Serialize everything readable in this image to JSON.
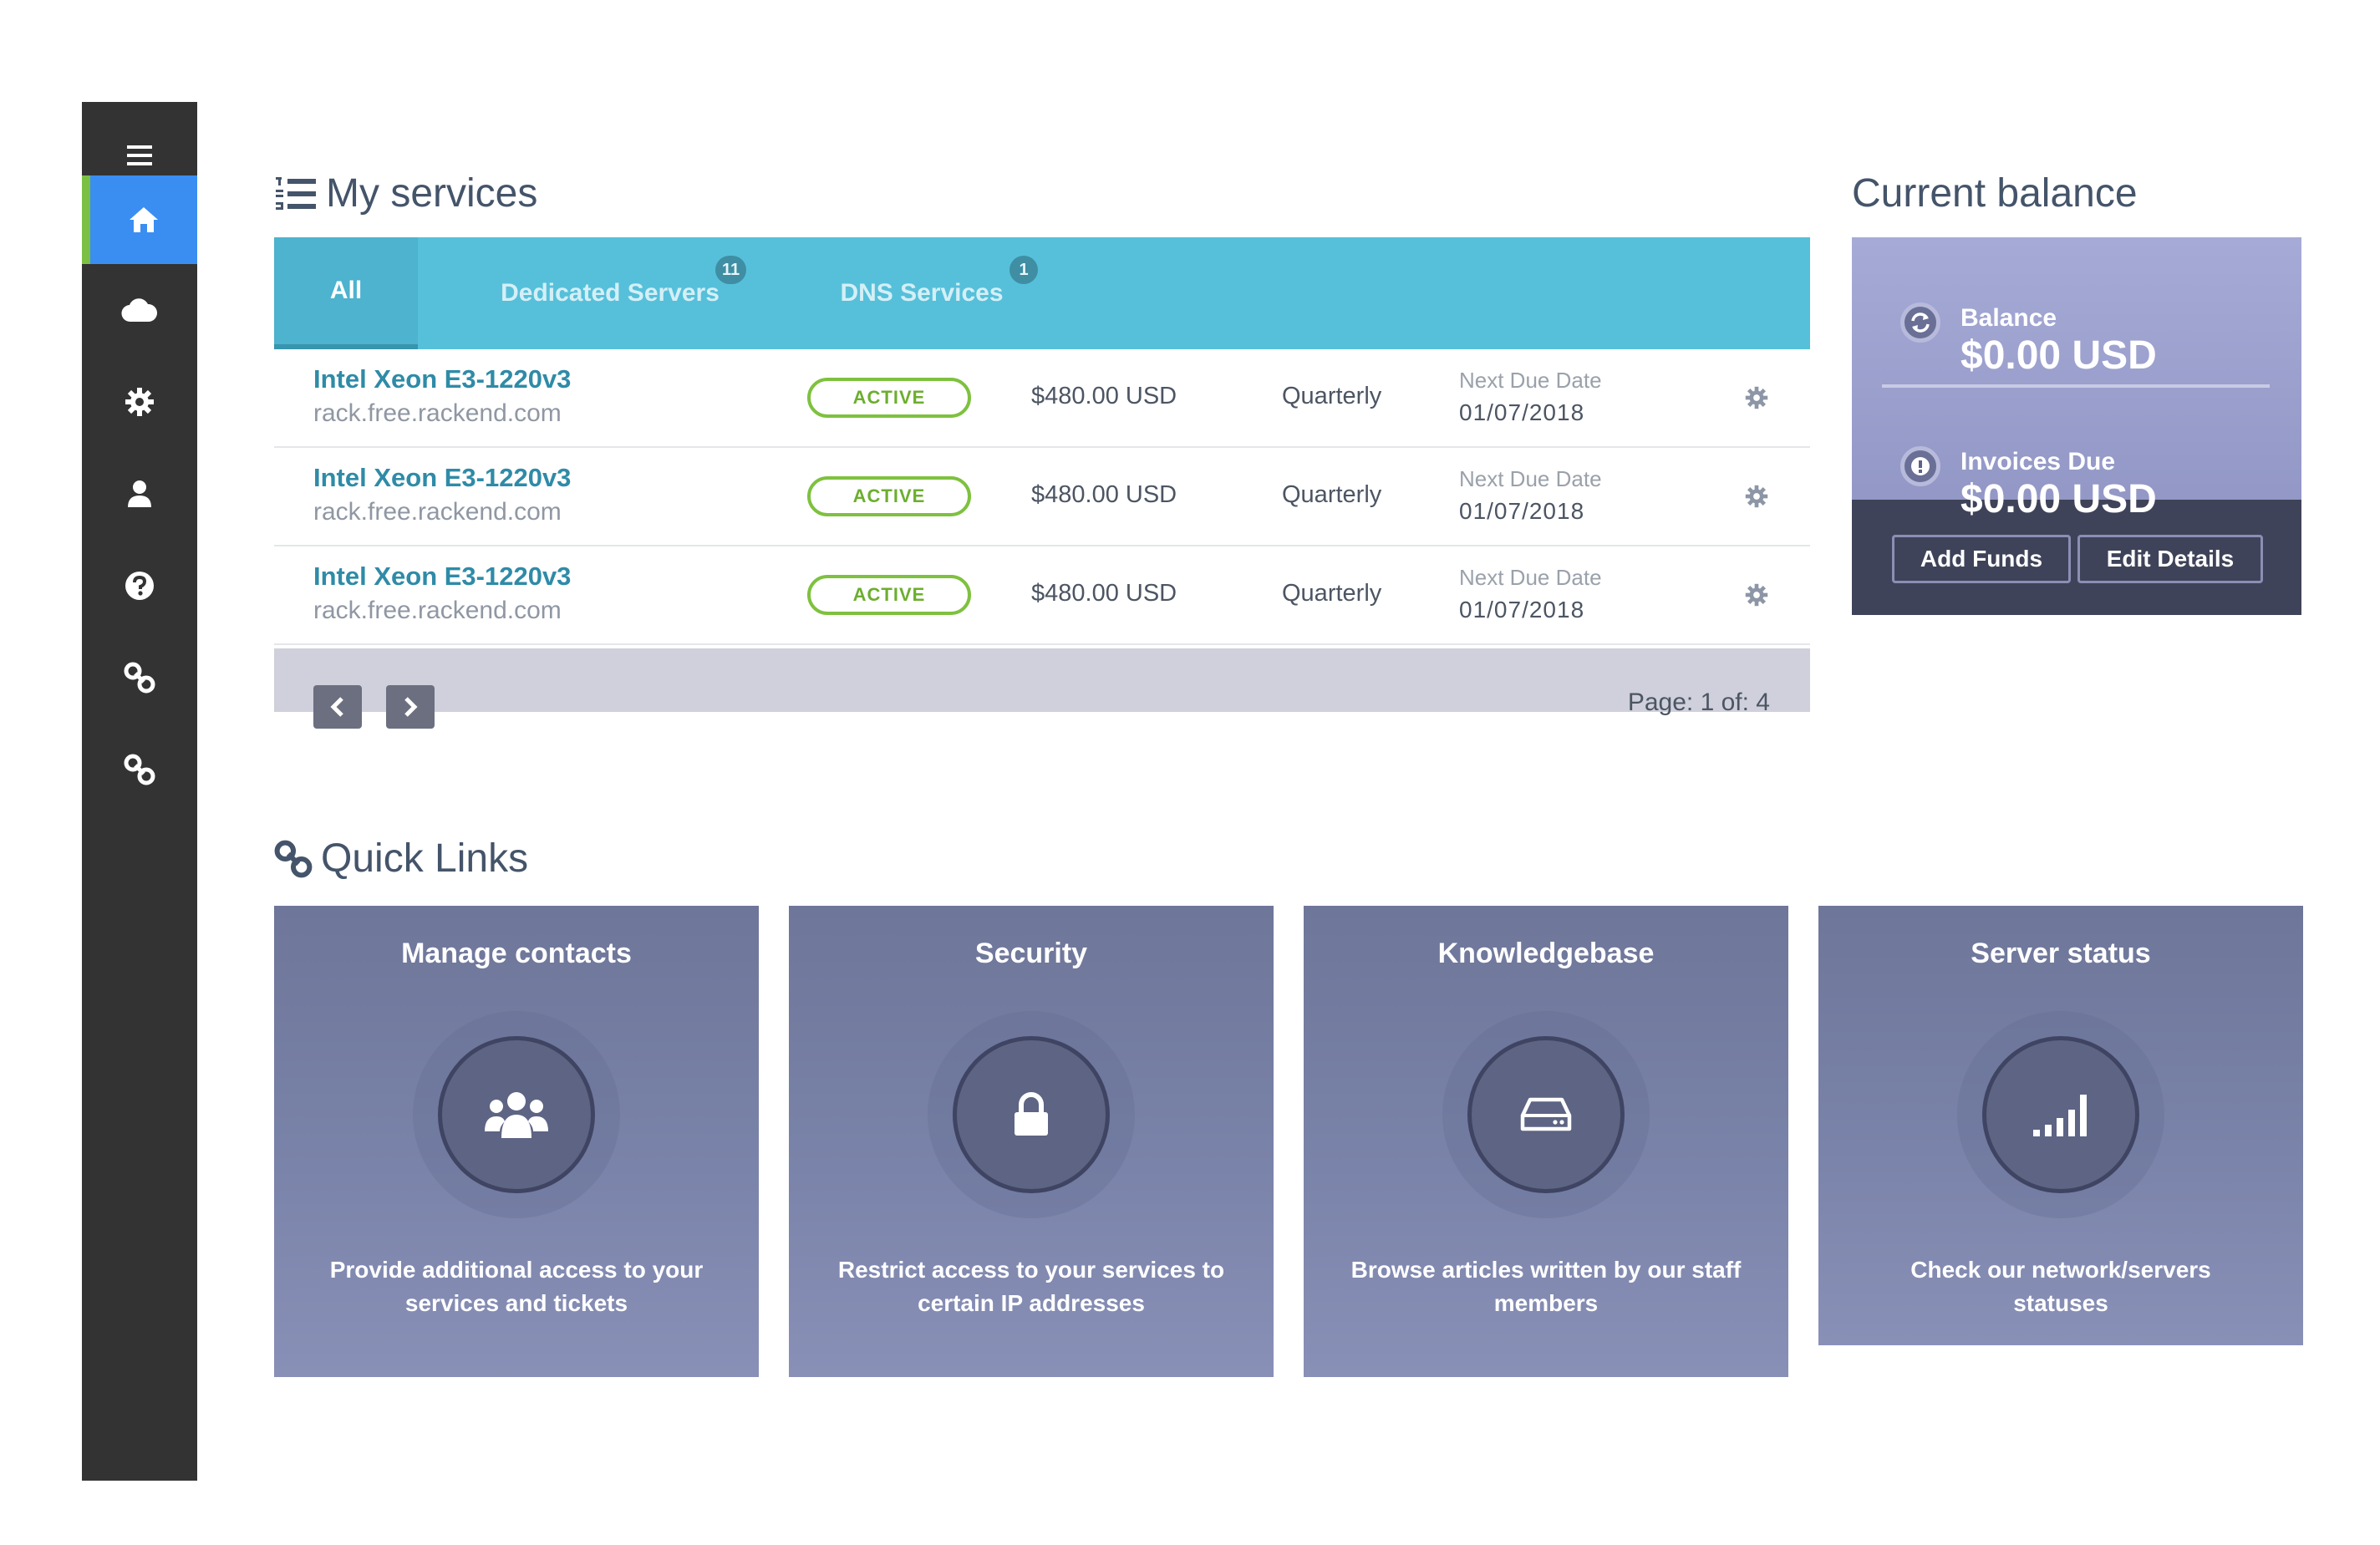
{
  "sidebar": {
    "items": [
      {
        "icon": "home-icon",
        "active": true
      },
      {
        "icon": "cloud-icon"
      },
      {
        "icon": "gear-icon"
      },
      {
        "icon": "user-icon"
      },
      {
        "icon": "question-icon"
      },
      {
        "icon": "link-icon"
      },
      {
        "icon": "link-icon"
      }
    ]
  },
  "services": {
    "title": "My services",
    "tabs": [
      {
        "label": "All",
        "active": true
      },
      {
        "label": "Dedicated Servers",
        "badge": "11"
      },
      {
        "label": "DNS Services",
        "badge": "1"
      }
    ],
    "rows": [
      {
        "name": "Intel Xeon E3-1220v3",
        "host": "rack.free.rackend.com",
        "status": "ACTIVE",
        "price": "$480.00 USD",
        "cycle": "Quarterly",
        "due_label": "Next Due Date",
        "due": "01/07/2018"
      },
      {
        "name": "Intel Xeon E3-1220v3",
        "host": "rack.free.rackend.com",
        "status": "ACTIVE",
        "price": "$480.00 USD",
        "cycle": "Quarterly",
        "due_label": "Next Due Date",
        "due": "01/07/2018"
      },
      {
        "name": "Intel Xeon E3-1220v3",
        "host": "rack.free.rackend.com",
        "status": "ACTIVE",
        "price": "$480.00 USD",
        "cycle": "Quarterly",
        "due_label": "Next Due Date",
        "due": "01/07/2018"
      }
    ],
    "pagination": {
      "text": "Page: 1 of: 4"
    }
  },
  "balance": {
    "title": "Current balance",
    "balance_label": "Balance",
    "balance_value": "$0.00 USD",
    "invoices_label": "Invoices Due",
    "invoices_value": "$0.00 USD",
    "add_funds": "Add Funds",
    "edit_details": "Edit Details"
  },
  "quick_links": {
    "title": "Quick Links",
    "cards": [
      {
        "title": "Manage contacts",
        "icon": "users-icon",
        "desc_line1": "Provide additional access to your",
        "desc_line2": "services and tickets"
      },
      {
        "title": "Security",
        "icon": "lock-icon",
        "desc_line1": "Restrict access to your services to",
        "desc_line2": "certain IP addresses"
      },
      {
        "title": "Knowledgebase",
        "icon": "hard-drive-icon",
        "desc_line1": "Browse articles written by our staff",
        "desc_line2": "members"
      },
      {
        "title": "Server status",
        "icon": "signal-bars-icon",
        "desc_line1": "Check our network/servers statuses",
        "desc_line2": ""
      }
    ]
  },
  "colors": {
    "sidebar": "#333333",
    "sidebar_active": "#3a8ef1",
    "tab_bar": "#56c0da",
    "status_active": "#7ec13f",
    "card": "#7a83a9"
  }
}
